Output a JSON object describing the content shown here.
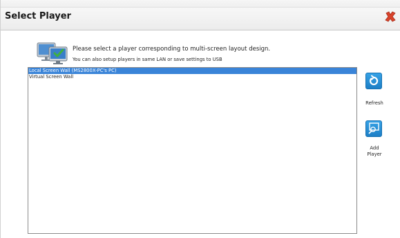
{
  "window": {
    "title": "Select Player"
  },
  "header": {
    "icon": "monitor-check-icon",
    "message": "Please select a player corresponding to multi-screen layout design.",
    "submessage": "You can also setup players in same LAN or save settings to USB"
  },
  "player_list": {
    "items": [
      {
        "label": "Local Screen Wall (MS2800X-PC's PC)",
        "selected": true
      },
      {
        "label": "Virtual Screen Wall",
        "selected": false
      }
    ]
  },
  "actions": {
    "refresh_label": "Refresh",
    "add_player_label": "Add\nPlayer"
  },
  "colors": {
    "selection": "#3a84d8",
    "button_blue": "#1d7fc6",
    "close_red": "#d9432b"
  }
}
